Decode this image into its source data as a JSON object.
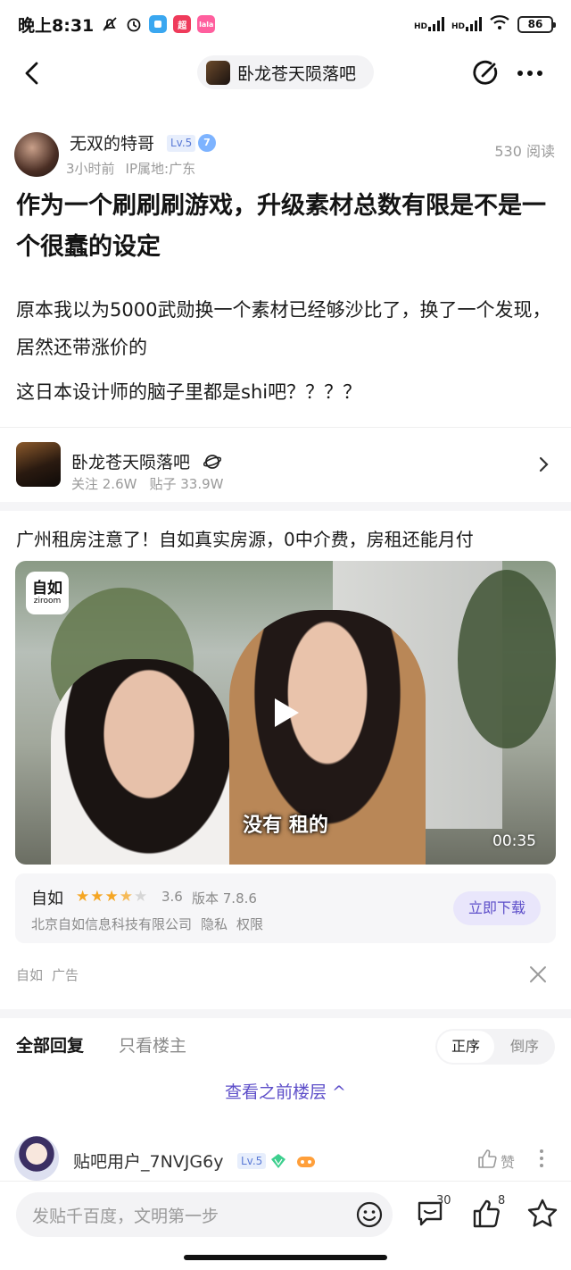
{
  "status_bar": {
    "time": "晚上8:31",
    "app_icon_2": "超",
    "app_icon_3": "lala",
    "signal_1": "HD",
    "signal_2": "HD",
    "battery": "86"
  },
  "nav": {
    "forum_title": "卧龙苍天陨落吧"
  },
  "post": {
    "author": "无双的特哥",
    "level": "Lv.5",
    "verify_level": "7",
    "time": "3小时前",
    "location": "IP属地:广东",
    "views": "530 阅读",
    "title": "作为一个刷刷刷游戏，升级素材总数有限是不是一个很蠢的设定",
    "body_1": "原本我以为5000武勋换一个素材已经够沙比了，换了一个发现，居然还带涨价的",
    "body_2": "这日本设计师的脑子里都是shi吧？？？？"
  },
  "forum_card": {
    "name": "卧龙苍天陨落吧",
    "followers": "关注 2.6W",
    "posts": "贴子 33.9W"
  },
  "ad": {
    "title": "广州租房注意了！自如真实房源，0中介费，房租还能月付",
    "logo_line1": "自如",
    "logo_line2": "ziroom",
    "subtitle": "没有 租的",
    "duration": "00:35",
    "app_name": "自如",
    "rating_value": 3.6,
    "rating": "3.6",
    "version": "版本 7.8.6",
    "company": "北京自如信息科技有限公司",
    "privacy": "隐私",
    "permissions": "权限",
    "download": "立即下载",
    "source": "自如",
    "ad_label": "广告"
  },
  "replies": {
    "tab_all": "全部回复",
    "tab_op": "只看楼主",
    "sort_asc": "正序",
    "sort_desc": "倒序",
    "prev_floors": "查看之前楼层 ^",
    "first": {
      "user": "贴吧用户_7NVJG6y",
      "level": "Lv.5",
      "like": "赞"
    }
  },
  "bottom": {
    "placeholder": "发贴千百度，文明第一步",
    "comments_count": "30",
    "likes_count": "8"
  },
  "colors": {
    "accent": "#5d4ec9",
    "star": "#f5a623"
  }
}
